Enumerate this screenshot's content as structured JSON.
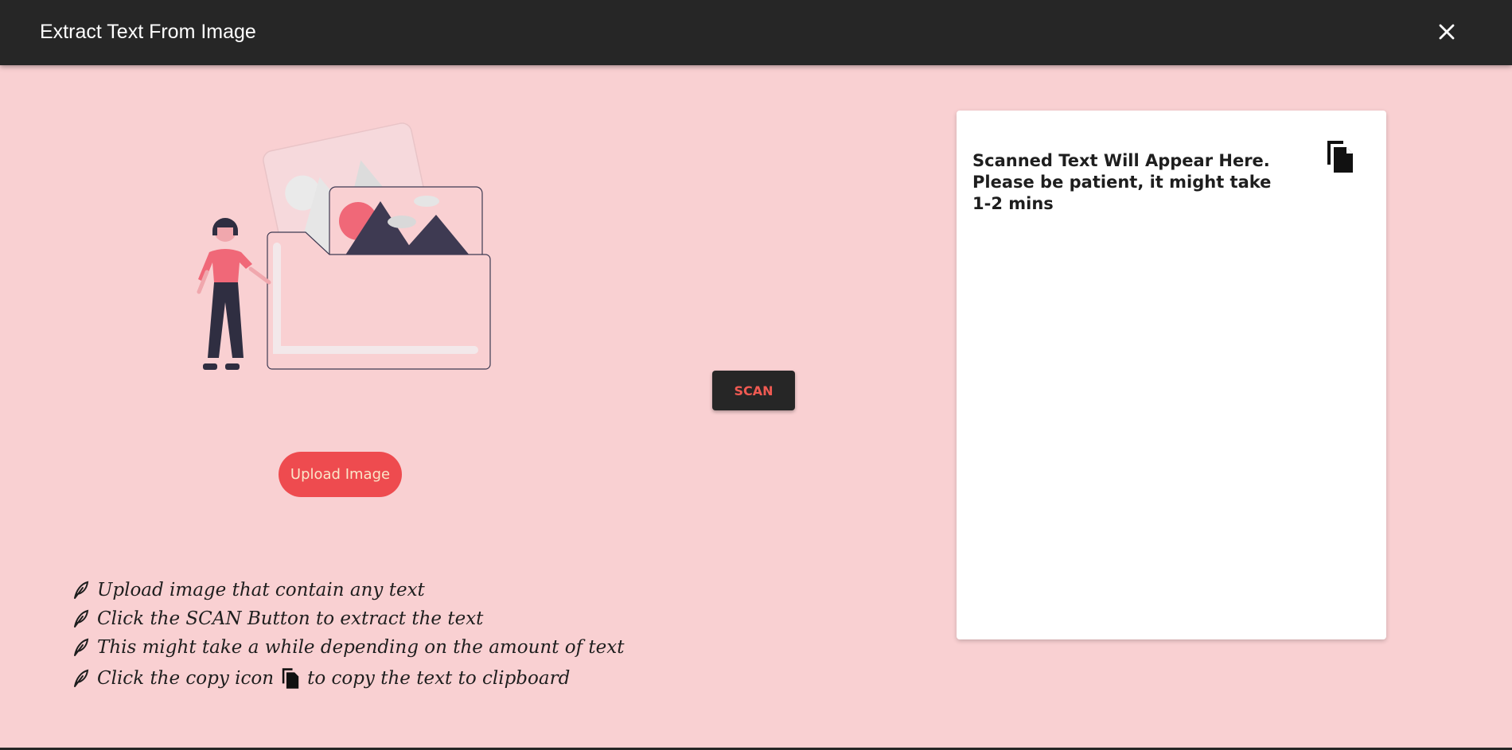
{
  "app": {
    "title": "Extract Text From Image"
  },
  "actions": {
    "upload_label": "Upload Image",
    "scan_label": "SCAN"
  },
  "output": {
    "placeholder": "Scanned Text Will Appear Here. Please be patient, it might take 1-2 mins"
  },
  "instructions": {
    "items": [
      "Upload image that contain any text",
      "Click the SCAN Button to extract the text",
      "This might take a while depending on the amount of text"
    ],
    "copy_before": "Click the copy icon",
    "copy_after": "to copy the text to clipboard"
  },
  "icons": {
    "close": "close-icon",
    "copy": "copy-icon",
    "bullet": "feather-icon"
  },
  "colors": {
    "background": "#f9d0d2",
    "topbar": "#262626",
    "accent": "#ee4b4f",
    "scan_text": "#f05a52"
  }
}
